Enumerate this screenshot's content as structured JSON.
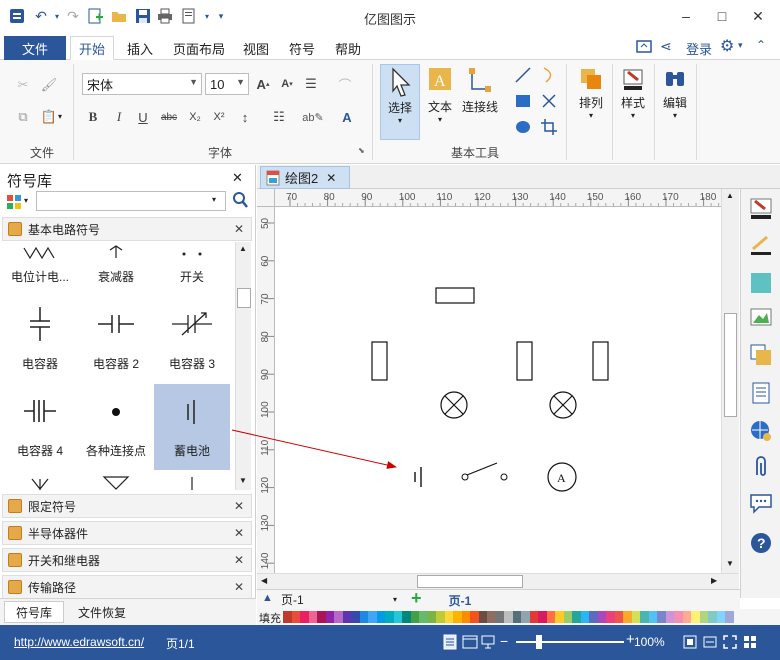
{
  "app": {
    "title": "亿图图示",
    "minimize": "–",
    "maximize": "□",
    "close": "✕"
  },
  "menu": {
    "file": "文件",
    "tabs": [
      "开始",
      "插入",
      "页面布局",
      "视图",
      "符号",
      "帮助"
    ],
    "active_tab": "开始",
    "login": "登录"
  },
  "ribbon": {
    "groups": {
      "file": "文件",
      "font": "字体",
      "basic_tools": "基本工具"
    },
    "font_name": "宋体",
    "font_size": "10",
    "big_buttons": {
      "select": "选择",
      "text": "文本",
      "connector": "连接线",
      "arrange": "排列",
      "style": "样式",
      "edit": "编辑"
    }
  },
  "library": {
    "title": "符号库",
    "search_placeholder": "",
    "section_open": "基本电路符号",
    "symbols_row1": [
      "电位计电...",
      "衰减器",
      "开关"
    ],
    "symbols_row2": [
      "电容器",
      "电容器 2",
      "电容器 3"
    ],
    "symbols_row3": [
      "电容器 4",
      "各种连接点",
      "蓄电池"
    ],
    "selected_symbol": "蓄电池",
    "sections_collapsed": [
      "限定符号",
      "半导体器件",
      "开关和继电器",
      "传输路径"
    ],
    "bottom_tabs": [
      "符号库",
      "文件恢复"
    ]
  },
  "document": {
    "tab_title": "绘图2",
    "hruler_ticks": [
      "70",
      "80",
      "90",
      "100",
      "110",
      "120",
      "130",
      "140",
      "150",
      "160",
      "170",
      "180"
    ],
    "vruler_ticks": [
      "50",
      "60",
      "70",
      "80",
      "90",
      "100",
      "110",
      "120",
      "130",
      "140"
    ]
  },
  "pagebar": {
    "page_select": "页-1",
    "page_tab": "页-1",
    "add_icon": "+"
  },
  "fill_label": "填充",
  "palette": [
    "#c0392b",
    "#e74c3c",
    "#e91e63",
    "#f06292",
    "#ad1457",
    "#8e24aa",
    "#ba68c8",
    "#5e35b1",
    "#3949ab",
    "#1e88e5",
    "#42a5f5",
    "#039be5",
    "#00acc1",
    "#26c6da",
    "#00897b",
    "#43a047",
    "#66bb6a",
    "#7cb342",
    "#c0ca33",
    "#fdd835",
    "#ffb300",
    "#fb8c00",
    "#f4511e",
    "#6d4c41",
    "#8d6e63",
    "#757575",
    "#bdbdbd",
    "#546e7a",
    "#90a4ae",
    "#e53935",
    "#d81b60",
    "#ff7043",
    "#ffca28",
    "#9ccc65",
    "#26a69a",
    "#29b6f6",
    "#5c6bc0",
    "#ab47bc",
    "#ec407a",
    "#ef5350",
    "#ffa726",
    "#d4e157",
    "#4db6ac",
    "#4fc3f7",
    "#7986cb",
    "#ce93d8",
    "#f48fb1",
    "#ffab91",
    "#fff176",
    "#aed581",
    "#80cbc4",
    "#81d4fa",
    "#9fa8da"
  ],
  "status": {
    "url": "http://www.edrawsoft.cn/",
    "page_info": "页1/1",
    "zoom": "100%"
  },
  "colors": {
    "brand": "#2b579a",
    "selected": "#b7c8e5",
    "arrow": "#cc0000"
  }
}
